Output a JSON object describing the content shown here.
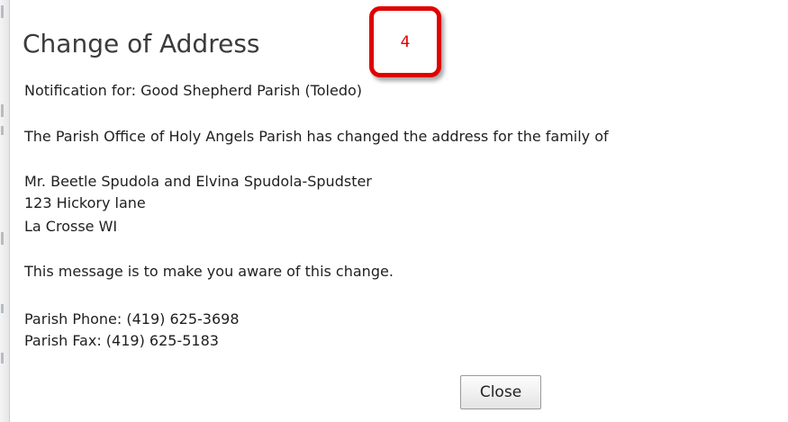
{
  "dialog": {
    "title": "Change of Address",
    "step_badge": "4",
    "notification": "Notification for: Good Shepherd Parish (Toledo)",
    "change_line": "The Parish Office of Holy Angels Parish has changed the address for the family of",
    "family_name": "Mr. Beetle Spudola and Elvina Spudola-Spudster",
    "address_street": "123 Hickory lane",
    "address_city": "La Crosse WI",
    "awareness_message": "This message is to make you aware of this change.",
    "phone": "Parish Phone: (419) 625-3698",
    "fax": "Parish Fax: (419) 625-5183",
    "close_label": "Close"
  },
  "colors": {
    "badge_red": "#e00000",
    "title_gray": "#3b3b3b"
  }
}
